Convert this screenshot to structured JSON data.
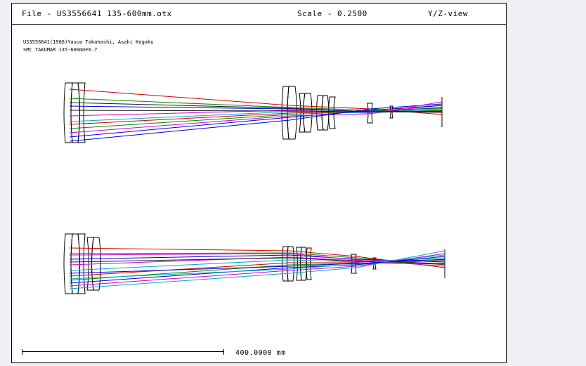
{
  "header": {
    "file": "File - US3556641 135-600mm.otx",
    "scale": "Scale - 0.2500",
    "view": "Y/Z-view"
  },
  "notes": {
    "line1": "US3556641(1966)Yasuo Takahashi, Asahi Kogaku",
    "line2": "SMC TAKUMAR 135-600mmF6.7"
  },
  "scale_bar": {
    "label": "400.0000 mm"
  },
  "colors": {
    "rays": [
      "#d40000",
      "#008a00",
      "#0000d8",
      "#d000d0",
      "#00a8c8",
      "#1a1a1a"
    ],
    "lens": "#000000"
  }
}
